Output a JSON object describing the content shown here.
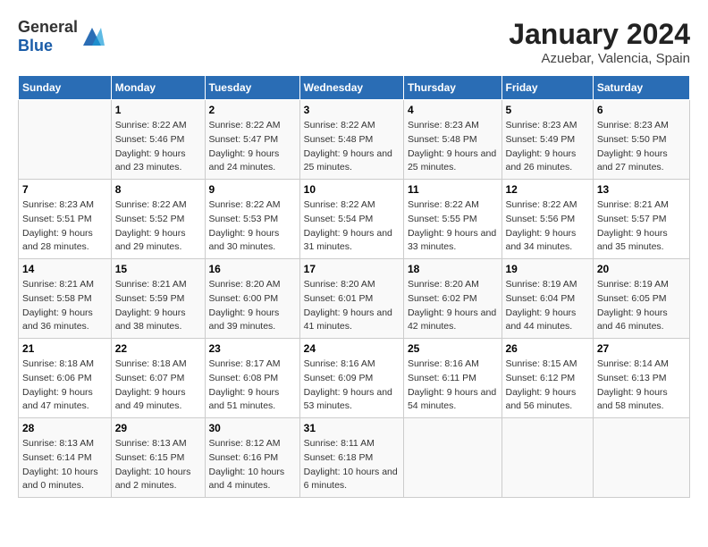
{
  "logo": {
    "text_general": "General",
    "text_blue": "Blue"
  },
  "title": "January 2024",
  "subtitle": "Azuebar, Valencia, Spain",
  "days_of_week": [
    "Sunday",
    "Monday",
    "Tuesday",
    "Wednesday",
    "Thursday",
    "Friday",
    "Saturday"
  ],
  "weeks": [
    [
      {
        "day": "",
        "sunrise": "",
        "sunset": "",
        "daylight": ""
      },
      {
        "day": "1",
        "sunrise": "Sunrise: 8:22 AM",
        "sunset": "Sunset: 5:46 PM",
        "daylight": "Daylight: 9 hours and 23 minutes."
      },
      {
        "day": "2",
        "sunrise": "Sunrise: 8:22 AM",
        "sunset": "Sunset: 5:47 PM",
        "daylight": "Daylight: 9 hours and 24 minutes."
      },
      {
        "day": "3",
        "sunrise": "Sunrise: 8:22 AM",
        "sunset": "Sunset: 5:48 PM",
        "daylight": "Daylight: 9 hours and 25 minutes."
      },
      {
        "day": "4",
        "sunrise": "Sunrise: 8:23 AM",
        "sunset": "Sunset: 5:48 PM",
        "daylight": "Daylight: 9 hours and 25 minutes."
      },
      {
        "day": "5",
        "sunrise": "Sunrise: 8:23 AM",
        "sunset": "Sunset: 5:49 PM",
        "daylight": "Daylight: 9 hours and 26 minutes."
      },
      {
        "day": "6",
        "sunrise": "Sunrise: 8:23 AM",
        "sunset": "Sunset: 5:50 PM",
        "daylight": "Daylight: 9 hours and 27 minutes."
      }
    ],
    [
      {
        "day": "7",
        "sunrise": "Sunrise: 8:23 AM",
        "sunset": "Sunset: 5:51 PM",
        "daylight": "Daylight: 9 hours and 28 minutes."
      },
      {
        "day": "8",
        "sunrise": "Sunrise: 8:22 AM",
        "sunset": "Sunset: 5:52 PM",
        "daylight": "Daylight: 9 hours and 29 minutes."
      },
      {
        "day": "9",
        "sunrise": "Sunrise: 8:22 AM",
        "sunset": "Sunset: 5:53 PM",
        "daylight": "Daylight: 9 hours and 30 minutes."
      },
      {
        "day": "10",
        "sunrise": "Sunrise: 8:22 AM",
        "sunset": "Sunset: 5:54 PM",
        "daylight": "Daylight: 9 hours and 31 minutes."
      },
      {
        "day": "11",
        "sunrise": "Sunrise: 8:22 AM",
        "sunset": "Sunset: 5:55 PM",
        "daylight": "Daylight: 9 hours and 33 minutes."
      },
      {
        "day": "12",
        "sunrise": "Sunrise: 8:22 AM",
        "sunset": "Sunset: 5:56 PM",
        "daylight": "Daylight: 9 hours and 34 minutes."
      },
      {
        "day": "13",
        "sunrise": "Sunrise: 8:21 AM",
        "sunset": "Sunset: 5:57 PM",
        "daylight": "Daylight: 9 hours and 35 minutes."
      }
    ],
    [
      {
        "day": "14",
        "sunrise": "Sunrise: 8:21 AM",
        "sunset": "Sunset: 5:58 PM",
        "daylight": "Daylight: 9 hours and 36 minutes."
      },
      {
        "day": "15",
        "sunrise": "Sunrise: 8:21 AM",
        "sunset": "Sunset: 5:59 PM",
        "daylight": "Daylight: 9 hours and 38 minutes."
      },
      {
        "day": "16",
        "sunrise": "Sunrise: 8:20 AM",
        "sunset": "Sunset: 6:00 PM",
        "daylight": "Daylight: 9 hours and 39 minutes."
      },
      {
        "day": "17",
        "sunrise": "Sunrise: 8:20 AM",
        "sunset": "Sunset: 6:01 PM",
        "daylight": "Daylight: 9 hours and 41 minutes."
      },
      {
        "day": "18",
        "sunrise": "Sunrise: 8:20 AM",
        "sunset": "Sunset: 6:02 PM",
        "daylight": "Daylight: 9 hours and 42 minutes."
      },
      {
        "day": "19",
        "sunrise": "Sunrise: 8:19 AM",
        "sunset": "Sunset: 6:04 PM",
        "daylight": "Daylight: 9 hours and 44 minutes."
      },
      {
        "day": "20",
        "sunrise": "Sunrise: 8:19 AM",
        "sunset": "Sunset: 6:05 PM",
        "daylight": "Daylight: 9 hours and 46 minutes."
      }
    ],
    [
      {
        "day": "21",
        "sunrise": "Sunrise: 8:18 AM",
        "sunset": "Sunset: 6:06 PM",
        "daylight": "Daylight: 9 hours and 47 minutes."
      },
      {
        "day": "22",
        "sunrise": "Sunrise: 8:18 AM",
        "sunset": "Sunset: 6:07 PM",
        "daylight": "Daylight: 9 hours and 49 minutes."
      },
      {
        "day": "23",
        "sunrise": "Sunrise: 8:17 AM",
        "sunset": "Sunset: 6:08 PM",
        "daylight": "Daylight: 9 hours and 51 minutes."
      },
      {
        "day": "24",
        "sunrise": "Sunrise: 8:16 AM",
        "sunset": "Sunset: 6:09 PM",
        "daylight": "Daylight: 9 hours and 53 minutes."
      },
      {
        "day": "25",
        "sunrise": "Sunrise: 8:16 AM",
        "sunset": "Sunset: 6:11 PM",
        "daylight": "Daylight: 9 hours and 54 minutes."
      },
      {
        "day": "26",
        "sunrise": "Sunrise: 8:15 AM",
        "sunset": "Sunset: 6:12 PM",
        "daylight": "Daylight: 9 hours and 56 minutes."
      },
      {
        "day": "27",
        "sunrise": "Sunrise: 8:14 AM",
        "sunset": "Sunset: 6:13 PM",
        "daylight": "Daylight: 9 hours and 58 minutes."
      }
    ],
    [
      {
        "day": "28",
        "sunrise": "Sunrise: 8:13 AM",
        "sunset": "Sunset: 6:14 PM",
        "daylight": "Daylight: 10 hours and 0 minutes."
      },
      {
        "day": "29",
        "sunrise": "Sunrise: 8:13 AM",
        "sunset": "Sunset: 6:15 PM",
        "daylight": "Daylight: 10 hours and 2 minutes."
      },
      {
        "day": "30",
        "sunrise": "Sunrise: 8:12 AM",
        "sunset": "Sunset: 6:16 PM",
        "daylight": "Daylight: 10 hours and 4 minutes."
      },
      {
        "day": "31",
        "sunrise": "Sunrise: 8:11 AM",
        "sunset": "Sunset: 6:18 PM",
        "daylight": "Daylight: 10 hours and 6 minutes."
      },
      {
        "day": "",
        "sunrise": "",
        "sunset": "",
        "daylight": ""
      },
      {
        "day": "",
        "sunrise": "",
        "sunset": "",
        "daylight": ""
      },
      {
        "day": "",
        "sunrise": "",
        "sunset": "",
        "daylight": ""
      }
    ]
  ]
}
